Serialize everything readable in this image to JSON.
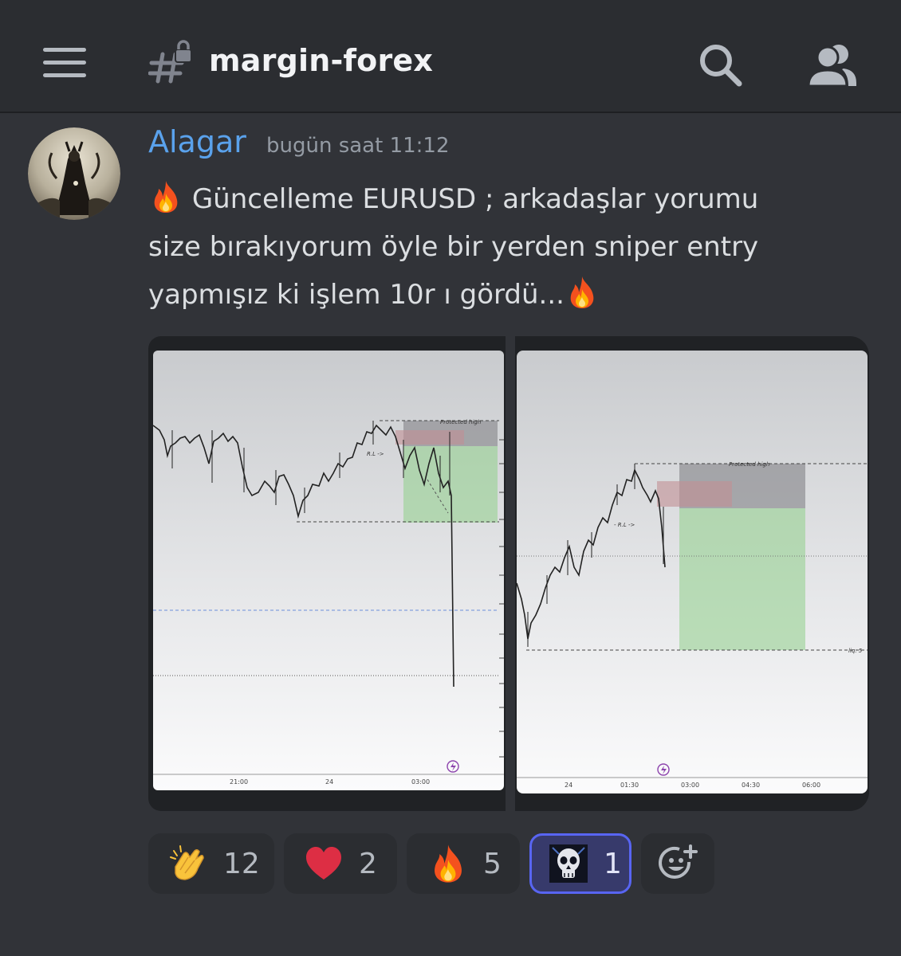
{
  "header": {
    "channel_name": "margin-forex",
    "menu_icon": "hamburger-menu-icon",
    "channel_icon": "locked-text-channel-icon",
    "search_icon": "search-icon",
    "members_icon": "members-icon"
  },
  "message": {
    "author": "Alagar",
    "author_color": "#5aa2ec",
    "timestamp": "bugün saat 11:12",
    "lines": [
      "Güncelleme EURUSD ; arkadaşlar yorumu",
      "size bırakıyorum öyle bir yerden sniper entry",
      "yapmışız ki işlem 10r ı gördü..."
    ],
    "emoji": "fire"
  },
  "attachments": [
    {
      "chart_labels": [
        "Protected high",
        "R.L ->"
      ],
      "time_axis": [
        "21:00",
        "24",
        "03:00"
      ]
    },
    {
      "chart_labels": [
        "Protected high",
        "- R.L ->",
        "liq. 5"
      ],
      "time_axis": [
        "24",
        "01:30",
        "03:00",
        "04:30",
        "06:00"
      ]
    }
  ],
  "reactions": [
    {
      "emoji": "clapping-hands",
      "count": "12"
    },
    {
      "emoji": "red-heart",
      "count": "2"
    },
    {
      "emoji": "fire",
      "count": "5"
    },
    {
      "emoji": "custom-skull-emoji",
      "count": "1",
      "selected": true
    },
    {
      "emoji": "add-reaction-icon"
    }
  ],
  "colors": {
    "background": "#313338",
    "header_bg": "#2b2d31",
    "selected_reaction_border": "#5865f2"
  }
}
